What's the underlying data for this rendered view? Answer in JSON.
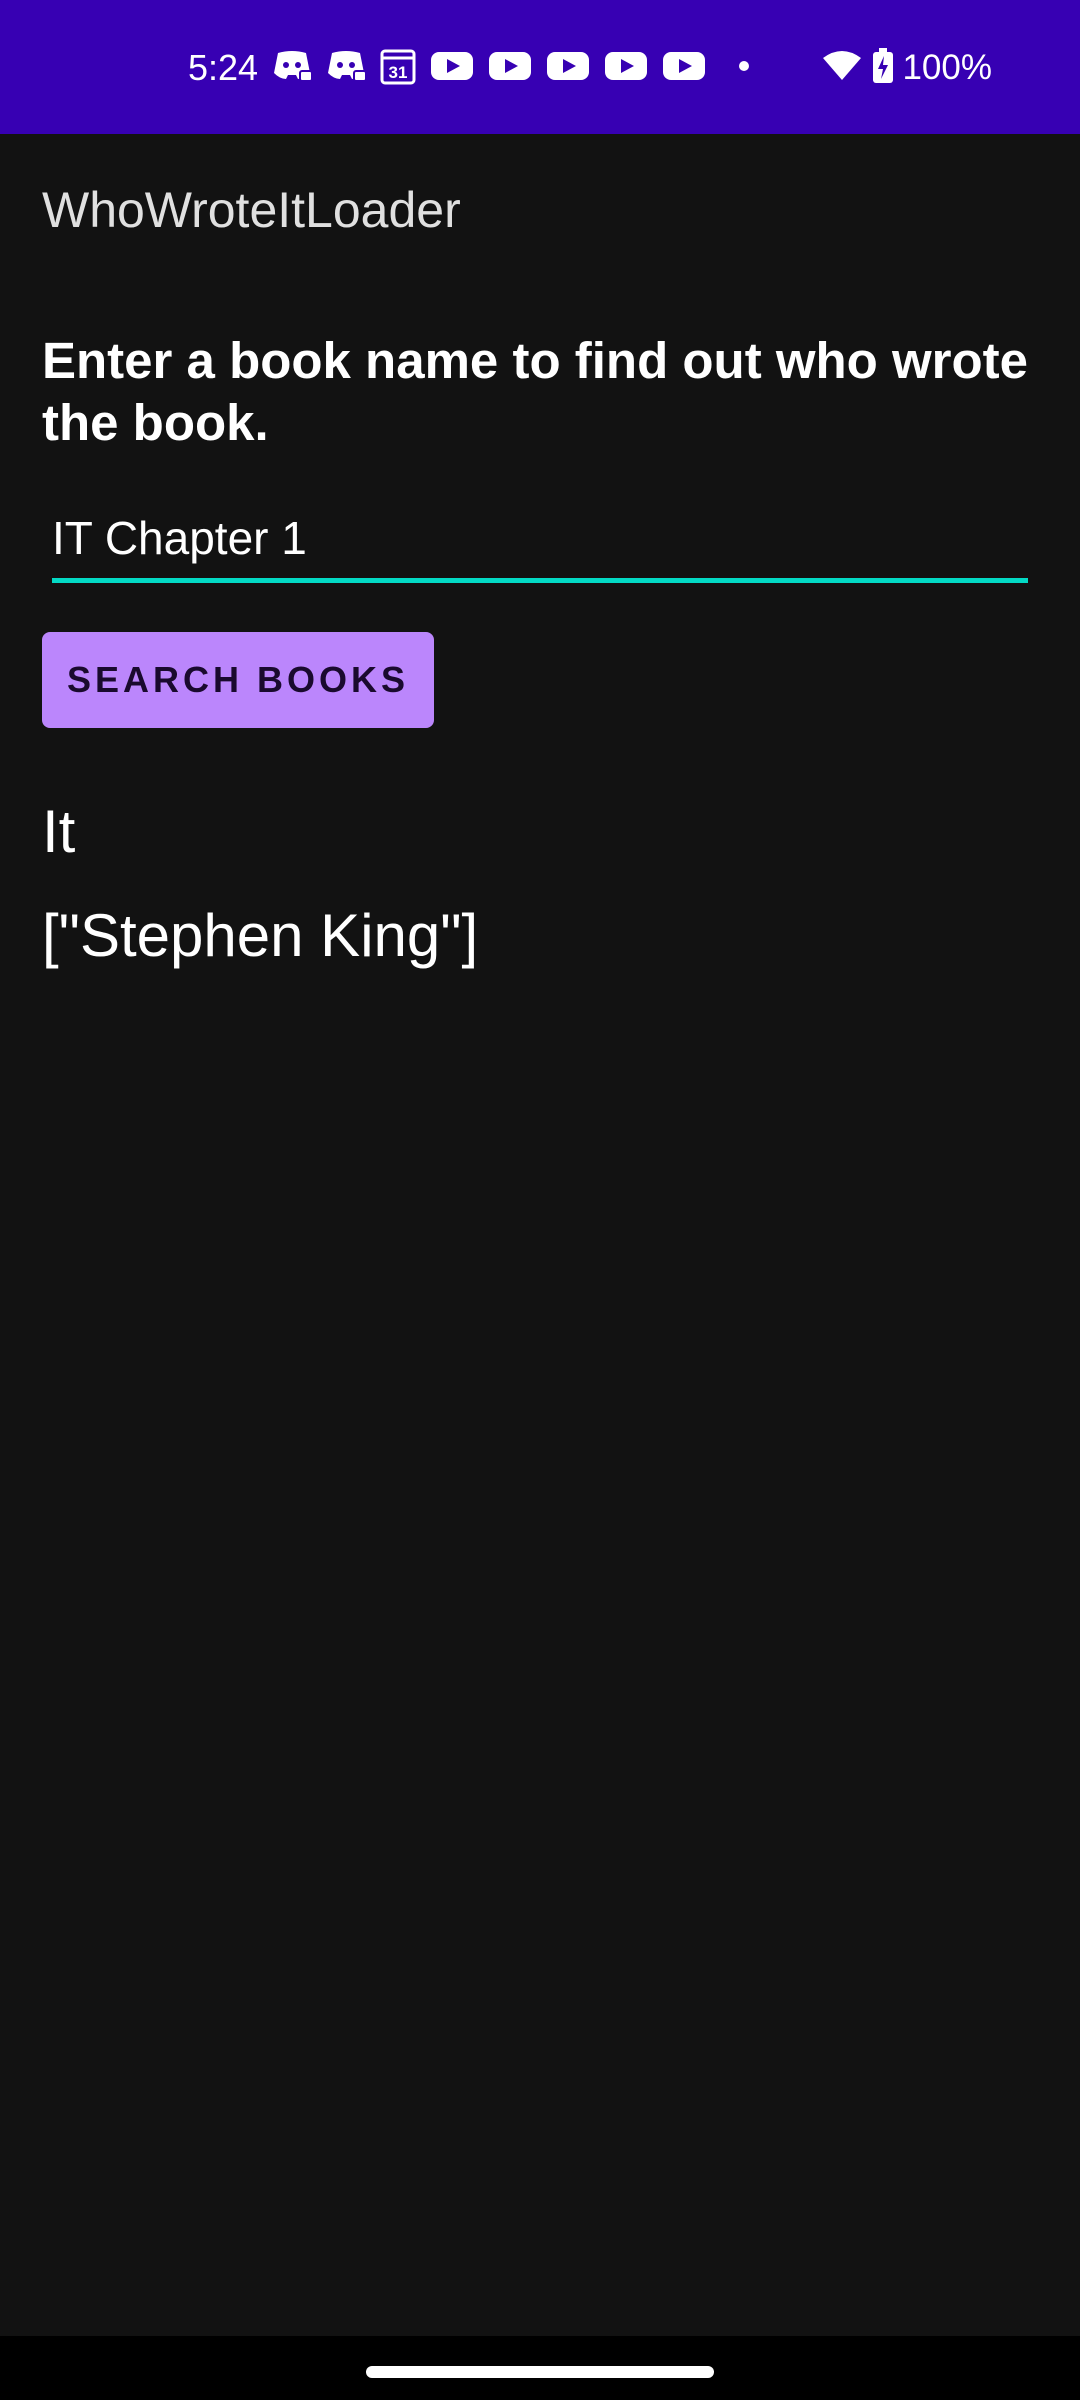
{
  "status_bar": {
    "time": "5:24",
    "battery": "100%",
    "icons": [
      "discord-icon",
      "discord-icon",
      "calendar-icon",
      "youtube-icon",
      "youtube-icon",
      "youtube-icon",
      "youtube-icon",
      "youtube-icon",
      "dot-icon",
      "wifi-icon",
      "battery-charging-icon"
    ],
    "calendar_day": "31",
    "background_color": "#3700B3"
  },
  "app_bar": {
    "title": "WhoWroteItLoader"
  },
  "main": {
    "instructions": "Enter a book name to find out who wrote the book.",
    "input_value": "IT Chapter 1",
    "search_button_label": "SEARCH BOOKS",
    "result_title": "It",
    "result_authors": "[\"Stephen King\"]"
  },
  "colors": {
    "background": "#121212",
    "accent": "#03DAC5",
    "button": "#BB86FC",
    "status_bar": "#3700B3"
  }
}
